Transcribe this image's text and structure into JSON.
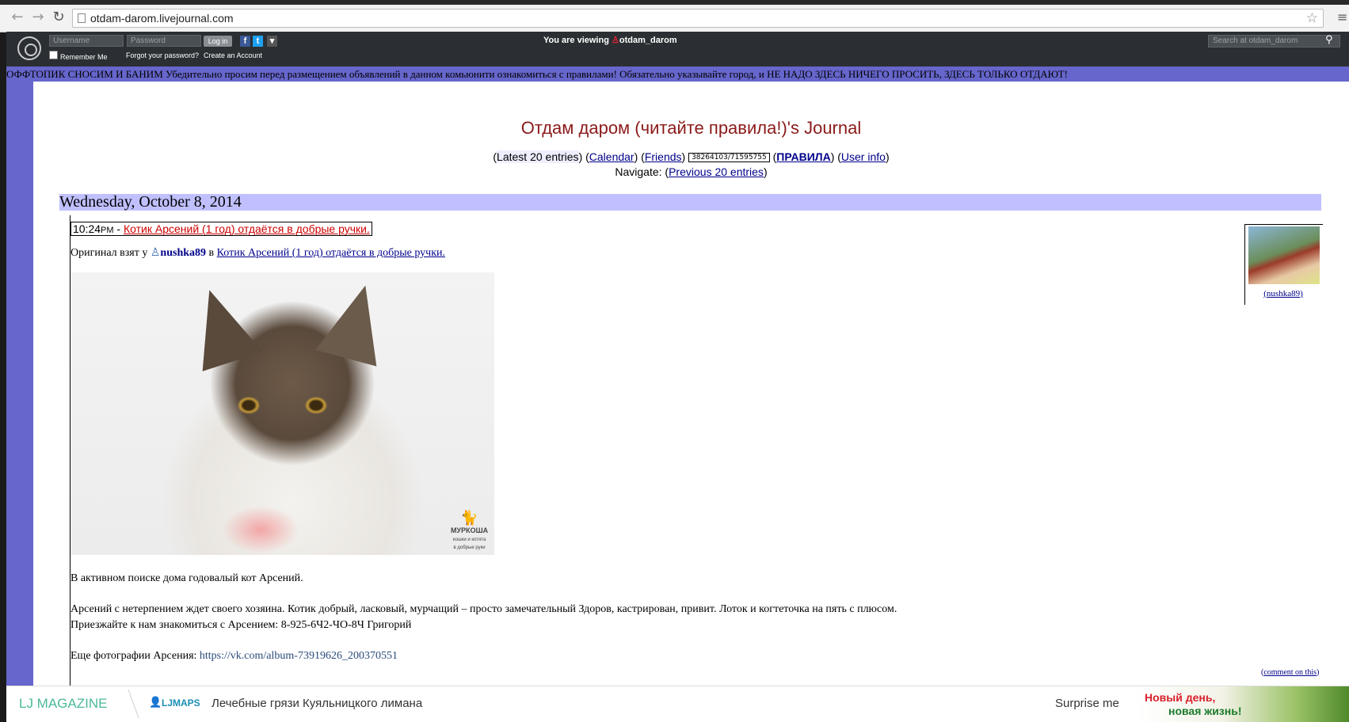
{
  "browser": {
    "url": "otdam-darom.livejournal.com",
    "back_glyph": "←",
    "forward_glyph": "→",
    "reload_glyph": "↻",
    "star_glyph": "☆",
    "menu_glyph": "≡"
  },
  "lj_bar": {
    "username_placeholder": "Username",
    "password_placeholder": "Password",
    "login_label": "Log in",
    "remember_label": "Remember Me",
    "forgot_label": "Forgot your password?",
    "create_label": "Create an Account",
    "viewing_prefix": "You are viewing",
    "viewing_user": "otdam_darom",
    "search_placeholder": "Search at otdam_darom",
    "facebook_glyph": "f",
    "twitter_glyph": "t",
    "dropdown_glyph": "▾",
    "search_glyph": "⚲"
  },
  "banner": "ОФФТОПИК СНОСИМ И БАНИМ Убедительно просим перед размещением объявлений в данном комьюнити ознакомиться с правилами! Обязательно указывайте город, и НЕ НАДО ЗДЕСЬ НИЧЕГО ПРОСИТЬ, ЗДЕСЬ ТОЛЬКО ОТДАЮТ!",
  "journal": {
    "title": "Отдам даром (читайте правила!)'s Journal",
    "nav": {
      "latest": "Latest 20 entries",
      "calendar": "Calendar",
      "friends": "Friends",
      "counter": "38264103/71595755",
      "rules": "ПРАВИЛА",
      "userinfo": "User info"
    },
    "navigate_label": "Navigate:",
    "prev_entries": "Previous 20 entries"
  },
  "date_header": "Wednesday, October 8, 2014",
  "entry": {
    "time": "10:24",
    "ampm": "PM",
    "subject": "Котик Арсений (1 год) отдаётся в добрые ручки.",
    "original_prefix": "Оригинал взят у",
    "original_user": "nushka89",
    "original_in": "в",
    "original_link": "Котик Арсений (1 год) отдаётся в добрые ручки.",
    "watermark_line1": "МУРКОША",
    "watermark_line2": "кошки и котята",
    "watermark_line3": "в добрые руки",
    "para1": "В активном поиске дома годовалый кот Арсений.",
    "para2": "Арсений с нетерпением ждет своего хозяина. Котик добрый, ласковый, мурчащий – просто замечательный Здоров, кастрирован, привит. Лоток и когтеточка на пять с плюсом.",
    "para3": "Приезжайте к нам знакомиться с Арсением: 8-925-6Ч2-ЧО-8Ч Григорий",
    "para4_prefix": "Еще фотографии Арсения:",
    "para4_link": "https://vk.com/album-73919626_200370551",
    "userpic_link": "(nushka89)",
    "comment_link": "comment on this"
  },
  "bottom_bar": {
    "magazine": "LJ MAGAZINE",
    "ljmaps": "LJMAPS",
    "headline": "Лечебные грязи Куяльницкого лимана",
    "surprise": "Surprise me",
    "ad_line1": "Новый день,",
    "ad_line2": "новая жизнь!"
  }
}
